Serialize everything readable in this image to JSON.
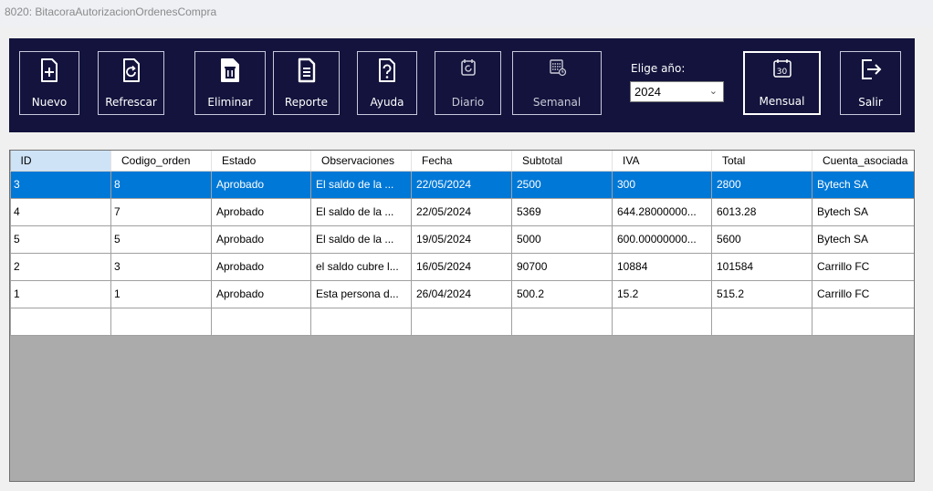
{
  "window": {
    "title": "8020: BitacoraAutorizacionOrdenesCompra"
  },
  "toolbar": {
    "nuevo": "Nuevo",
    "refrescar": "Refrescar",
    "eliminar": "Eliminar",
    "reporte": "Reporte",
    "ayuda": "Ayuda",
    "diario": "Diario",
    "semanal": "Semanal",
    "mensual": "Mensual",
    "salir": "Salir",
    "calendar_day": "30"
  },
  "year": {
    "label": "Elige año:",
    "value": "2024"
  },
  "grid": {
    "columns": [
      "ID",
      "Codigo_orden",
      "Estado",
      "Observaciones",
      "Fecha",
      "Subtotal",
      "IVA",
      "Total",
      "Cuenta_asociada"
    ],
    "rows": [
      [
        "3",
        "8",
        "Aprobado",
        "El saldo de la ...",
        "22/05/2024",
        "2500",
        "300",
        "2800",
        "Bytech SA"
      ],
      [
        "4",
        "7",
        "Aprobado",
        "El saldo de la ...",
        "22/05/2024",
        "5369",
        "644.28000000...",
        "6013.28",
        "Bytech SA"
      ],
      [
        "5",
        "5",
        "Aprobado",
        "El saldo de la ...",
        "19/05/2024",
        "5000",
        "600.00000000...",
        "5600",
        "Bytech SA"
      ],
      [
        "2",
        "3",
        "Aprobado",
        "el saldo cubre l...",
        "16/05/2024",
        "90700",
        "10884",
        "101584",
        "Carrillo FC"
      ],
      [
        "1",
        "1",
        "Aprobado",
        "Esta persona d...",
        "26/04/2024",
        "500.2",
        "15.2",
        "515.2",
        "Carrillo FC"
      ]
    ]
  },
  "colors": {
    "toolbar_bg": "#13133d",
    "selection": "#0078d7",
    "grid_empty": "#ababab"
  }
}
